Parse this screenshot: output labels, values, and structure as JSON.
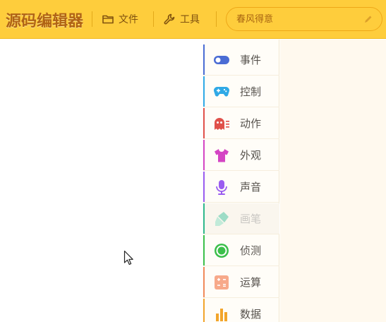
{
  "app": {
    "title": "源码编辑器"
  },
  "toolbar": {
    "file_label": "文件",
    "tools_label": "工具",
    "title_placeholder": "春风得意"
  },
  "categories": [
    {
      "label": "事件",
      "icon": "toggle-icon",
      "color": "#4a6cd4",
      "disabled": false
    },
    {
      "label": "控制",
      "icon": "gamepad-icon",
      "color": "#2fa9e6",
      "disabled": false
    },
    {
      "label": "动作",
      "icon": "ghost-icon",
      "color": "#e0504a",
      "disabled": false
    },
    {
      "label": "外观",
      "icon": "shirt-icon",
      "color": "#d445c4",
      "disabled": false
    },
    {
      "label": "声音",
      "icon": "microphone-icon",
      "color": "#9a5cf0",
      "disabled": false
    },
    {
      "label": "画笔",
      "icon": "brush-icon",
      "color": "#2fb88c",
      "disabled": true
    },
    {
      "label": "侦测",
      "icon": "radar-icon",
      "color": "#3bbf4a",
      "disabled": false
    },
    {
      "label": "运算",
      "icon": "calculator-icon",
      "color": "#f08a5a",
      "disabled": false
    },
    {
      "label": "数据",
      "icon": "bar-chart-icon",
      "color": "#f2a52b",
      "disabled": false
    }
  ]
}
